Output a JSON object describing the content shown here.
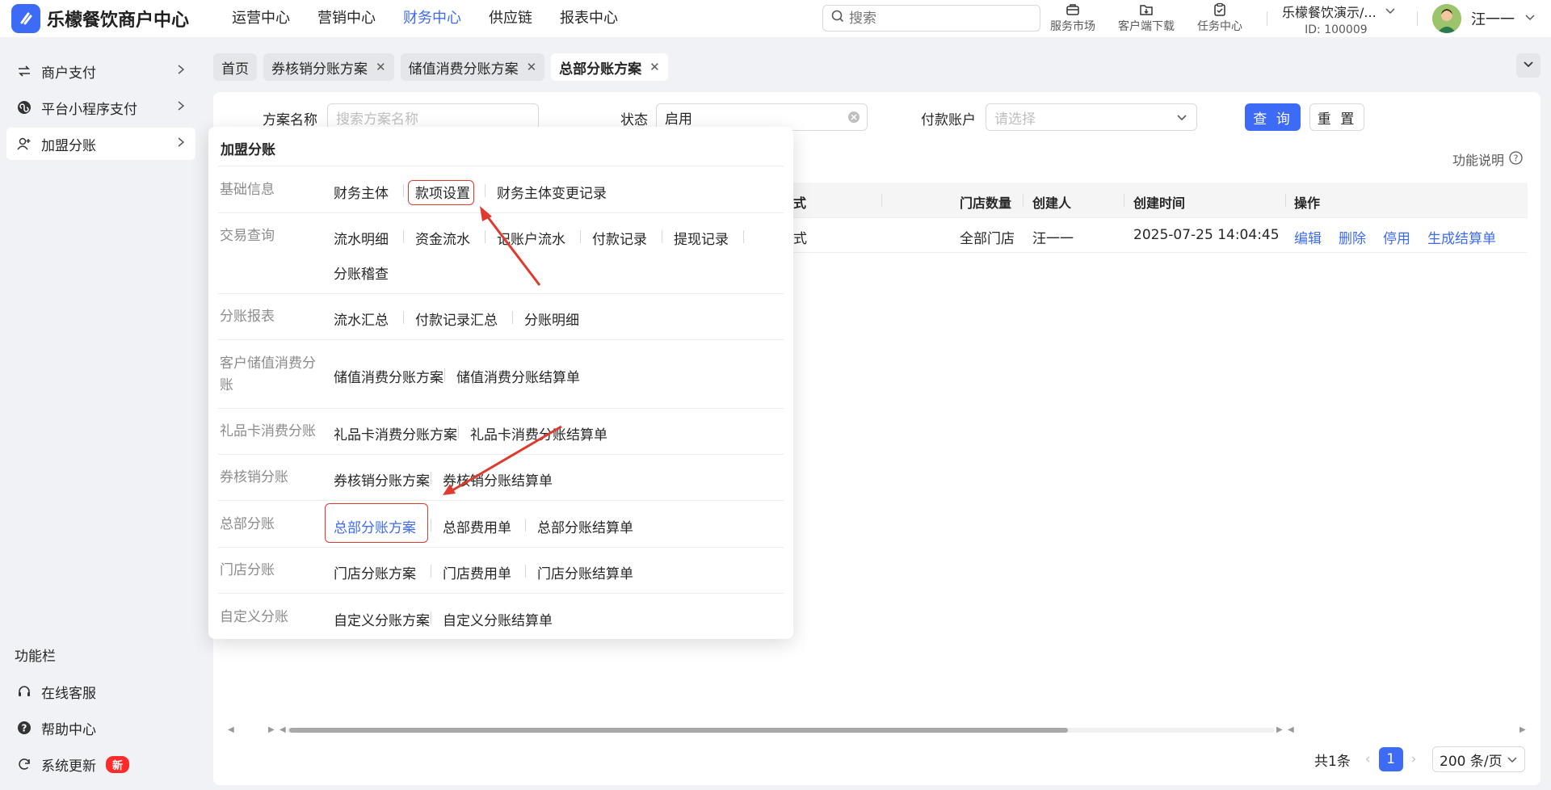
{
  "app": {
    "title": "乐檬餐饮商户中心"
  },
  "topnav": [
    {
      "label": "运营中心",
      "active": false
    },
    {
      "label": "营销中心",
      "active": false
    },
    {
      "label": "财务中心",
      "active": true
    },
    {
      "label": "供应链",
      "active": false
    },
    {
      "label": "报表中心",
      "active": false
    }
  ],
  "search": {
    "placeholder": "搜索"
  },
  "tools": {
    "market": "服务市场",
    "download": "客户端下载",
    "task": "任务中心"
  },
  "shop": {
    "name": "乐檬餐饮演示/...",
    "id": "ID: 100009"
  },
  "user": {
    "name": "汪一一"
  },
  "sidebar": {
    "items": [
      {
        "label": "商户支付",
        "icon": "exchange-icon"
      },
      {
        "label": "平台小程序支付",
        "icon": "mini-program-icon"
      },
      {
        "label": "加盟分账",
        "icon": "user-add-icon"
      }
    ],
    "section_label": "功能栏",
    "bottom": [
      {
        "label": "在线客服",
        "icon": "headset-icon"
      },
      {
        "label": "帮助中心",
        "icon": "help-icon"
      },
      {
        "label": "系统更新",
        "icon": "refresh-icon",
        "badge": "新"
      }
    ]
  },
  "tabs": [
    {
      "label": "首页",
      "closable": false
    },
    {
      "label": "券核销分账方案",
      "closable": true
    },
    {
      "label": "储值消费分账方案",
      "closable": true
    },
    {
      "label": "总部分账方案",
      "closable": true,
      "active": true
    }
  ],
  "filters": {
    "name_label": "方案名称",
    "name_placeholder": "搜索方案名称",
    "status_label": "状态",
    "status_value": "启用",
    "account_label": "付款账户",
    "account_placeholder": "请选择",
    "query_button": "查 询",
    "reset_button": "重 置"
  },
  "help_text": "功能说明",
  "table": {
    "headers": {
      "mode": "式",
      "store_count": "门店数量",
      "creator": "创建人",
      "created_at": "创建时间",
      "actions": "操作"
    },
    "row": {
      "mode": "式",
      "store_count": "全部门店",
      "creator": "汪一一",
      "created_at": "2025-07-25 14:04:45",
      "actions": [
        "编辑",
        "删除",
        "停用",
        "生成结算单"
      ]
    }
  },
  "pagination": {
    "total": "共1条",
    "current": "1",
    "page_size": "200 条/页"
  },
  "popup": {
    "title": "加盟分账",
    "groups": [
      {
        "category": "基础信息",
        "links": [
          "财务主体",
          "款项设置",
          "财务主体变更记录"
        ]
      },
      {
        "category": "交易查询",
        "links": [
          "流水明细",
          "资金流水",
          "记账户流水",
          "付款记录",
          "提现记录",
          "分账稽查"
        ]
      },
      {
        "category": "分账报表",
        "links": [
          "流水汇总",
          "付款记录汇总",
          "分账明细"
        ]
      },
      {
        "category": "客户储值消费分账",
        "links": [
          "储值消费分账方案",
          "储值消费分账结算单"
        ]
      },
      {
        "category": "礼品卡消费分账",
        "links": [
          "礼品卡消费分账方案",
          "礼品卡消费分账结算单"
        ]
      },
      {
        "category": "券核销分账",
        "links": [
          "券核销分账方案",
          "券核销分账结算单"
        ]
      },
      {
        "category": "总部分账",
        "links": [
          "总部分账方案",
          "总部费用单",
          "总部分账结算单"
        ]
      },
      {
        "category": "门店分账",
        "links": [
          "门店分账方案",
          "门店费用单",
          "门店分账结算单"
        ]
      },
      {
        "category": "自定义分账",
        "links": [
          "自定义分账方案",
          "自定义分账结算单"
        ]
      }
    ]
  },
  "colors": {
    "accent": "#3d6bf5",
    "highlight_box": "#e03a2f",
    "badge": "#ff2a2a"
  }
}
